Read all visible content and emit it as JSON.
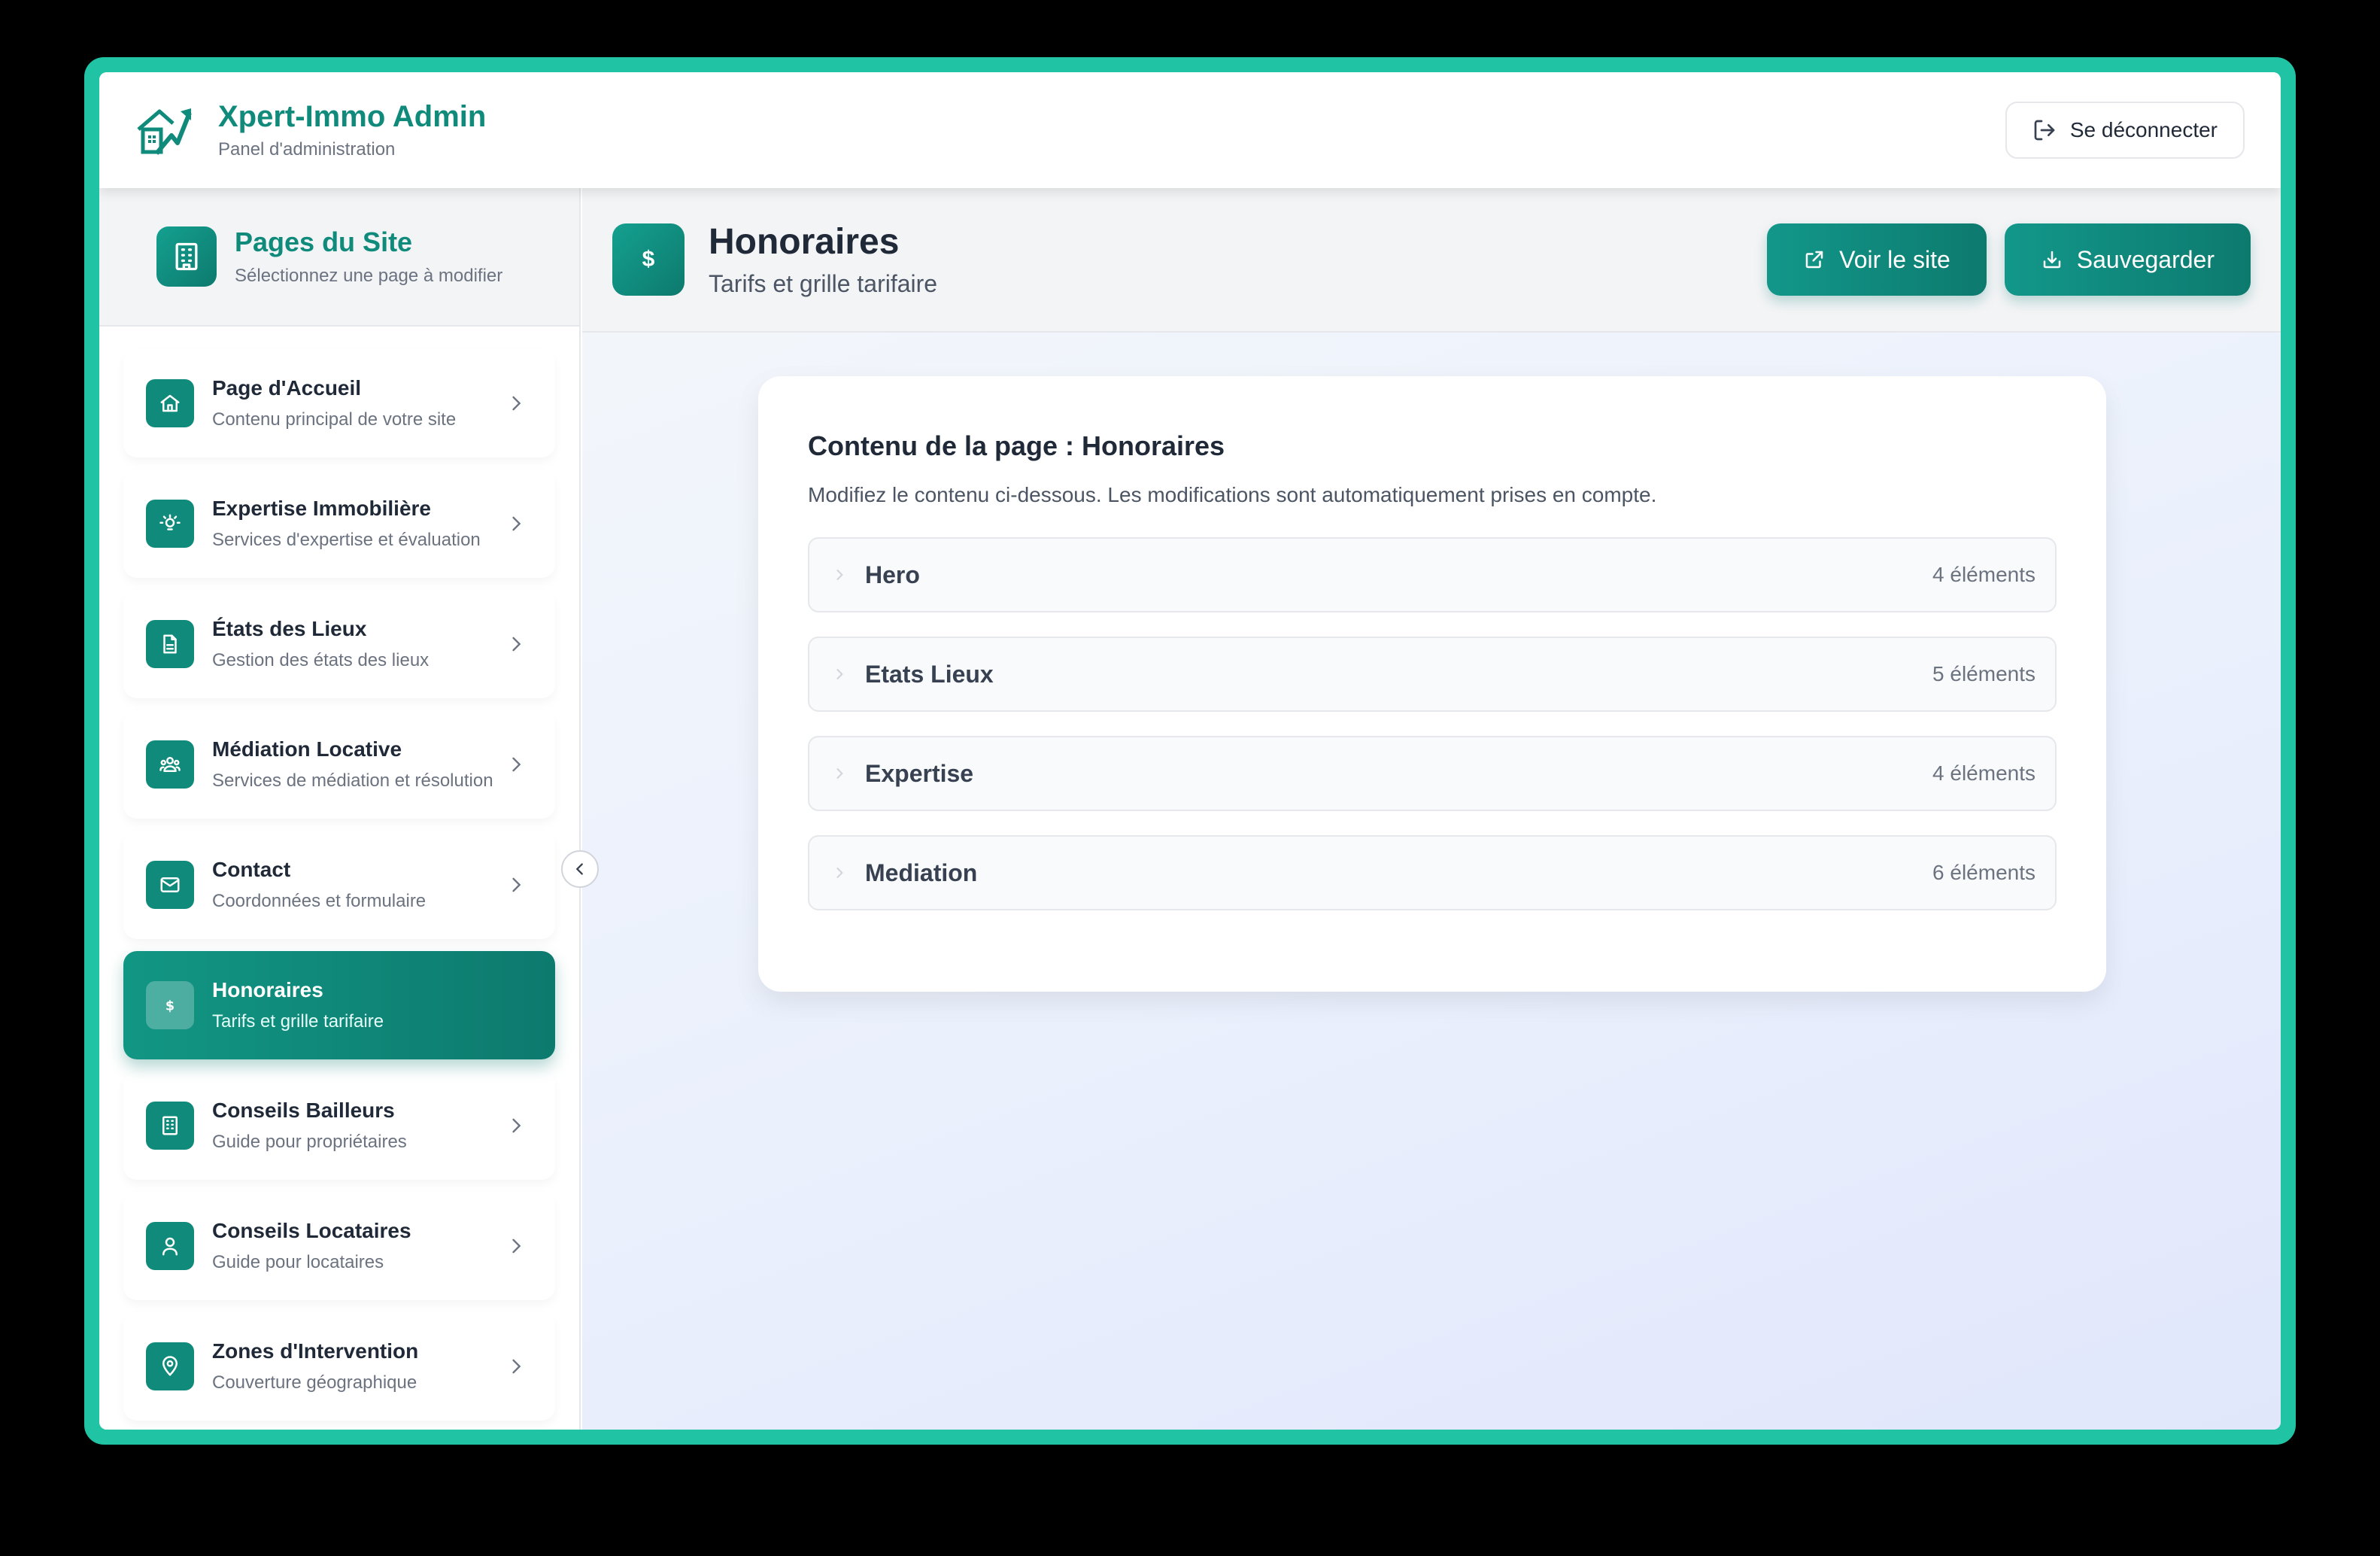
{
  "header": {
    "app_title": "Xpert-Immo Admin",
    "app_subtitle": "Panel d'administration",
    "logout_label": "Se déconnecter"
  },
  "sidebar": {
    "title": "Pages du Site",
    "subtitle": "Sélectionnez une page à modifier",
    "items": [
      {
        "label": "Page d'Accueil",
        "sub": "Contenu principal de votre site",
        "icon": "home-icon"
      },
      {
        "label": "Expertise Immobilière",
        "sub": "Services d'expertise et évaluation",
        "icon": "lightbulb-icon"
      },
      {
        "label": "États des Lieux",
        "sub": "Gestion des états des lieux",
        "icon": "document-icon"
      },
      {
        "label": "Médiation Locative",
        "sub": "Services de médiation et résolution",
        "icon": "users-icon"
      },
      {
        "label": "Contact",
        "sub": "Coordonnées et formulaire",
        "icon": "mail-icon"
      },
      {
        "label": "Honoraires",
        "sub": "Tarifs et grille tarifaire",
        "icon": "dollar-icon",
        "active": true
      },
      {
        "label": "Conseils Bailleurs",
        "sub": "Guide pour propriétaires",
        "icon": "building-icon"
      },
      {
        "label": "Conseils Locataires",
        "sub": "Guide pour locataires",
        "icon": "user-icon"
      },
      {
        "label": "Zones d'Intervention",
        "sub": "Couverture géographique",
        "icon": "map-pin-icon"
      }
    ]
  },
  "main": {
    "icon_glyph": "$",
    "title": "Honoraires",
    "subtitle": "Tarifs et grille tarifaire",
    "view_site_label": "Voir le site",
    "save_label": "Sauvegarder",
    "card": {
      "title": "Contenu de la page : Honoraires",
      "description": "Modifiez le contenu ci-dessous. Les modifications sont automatiquement prises en compte.",
      "sections": [
        {
          "label": "Hero",
          "count": "4 éléments"
        },
        {
          "label": "Etats Lieux",
          "count": "5 éléments"
        },
        {
          "label": "Expertise",
          "count": "4 éléments"
        },
        {
          "label": "Mediation",
          "count": "6 éléments"
        }
      ]
    }
  },
  "colors": {
    "accent": "#0f8a7b",
    "frame": "#20c3a3"
  }
}
